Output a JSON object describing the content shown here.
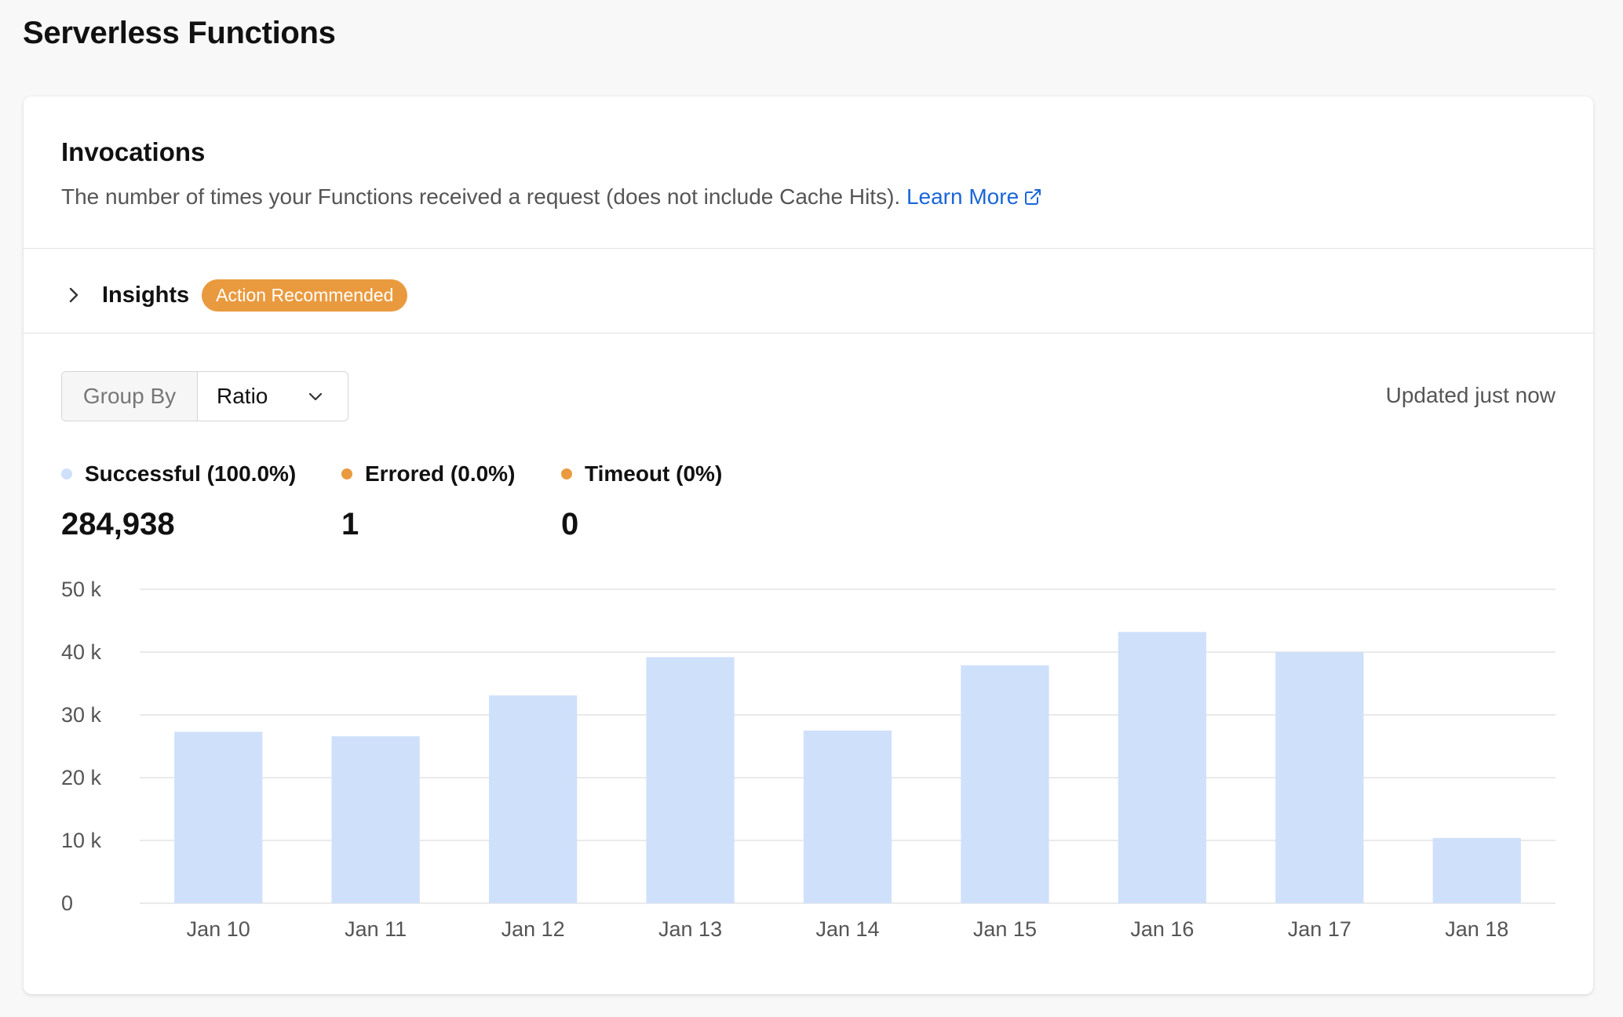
{
  "page": {
    "title": "Serverless Functions"
  },
  "card": {
    "title": "Invocations",
    "description": "The number of times your Functions received a request (does not include Cache Hits).",
    "learn_more": "Learn More"
  },
  "insights": {
    "label": "Insights",
    "badge": "Action Recommended"
  },
  "controls": {
    "group_by_label": "Group By",
    "group_by_value": "Ratio",
    "updated": "Updated just now"
  },
  "legend": [
    {
      "label": "Successful (100.0%)",
      "value": "284,938",
      "color": "#cfe0fb"
    },
    {
      "label": "Errored (0.0%)",
      "value": "1",
      "color": "#ea9a3e"
    },
    {
      "label": "Timeout (0%)",
      "value": "0",
      "color": "#ea9a3e"
    }
  ],
  "colors": {
    "accent_link": "#1a66d8",
    "badge": "#ea9a3e",
    "bar": "#cfe0fb"
  },
  "chart_data": {
    "type": "bar",
    "categories": [
      "Jan 10",
      "Jan 11",
      "Jan 12",
      "Jan 13",
      "Jan 14",
      "Jan 15",
      "Jan 16",
      "Jan 17",
      "Jan 18"
    ],
    "values": [
      27300,
      26600,
      33100,
      39200,
      27500,
      37900,
      43200,
      40000,
      10400
    ],
    "ylim": [
      0,
      50000
    ],
    "y_ticks": [
      0,
      10000,
      20000,
      30000,
      40000,
      50000
    ],
    "y_tick_labels": [
      "0",
      "10 k",
      "20 k",
      "30 k",
      "40 k",
      "50 k"
    ],
    "grid": true,
    "xlabel": "",
    "ylabel": ""
  }
}
